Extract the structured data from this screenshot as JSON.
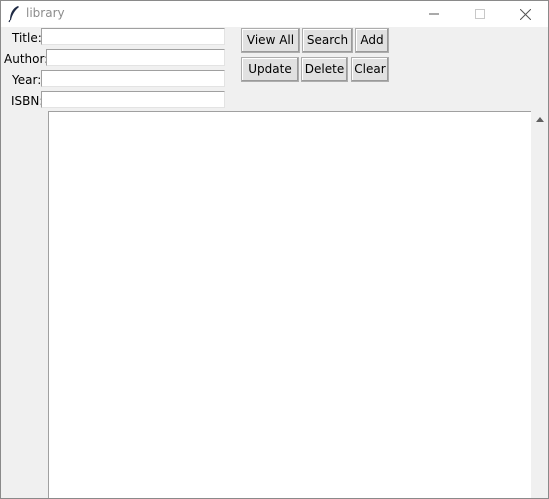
{
  "window": {
    "title": "library",
    "icon": "feather-icon",
    "controls": {
      "minimize": "minimize-icon",
      "maximize": "maximize-icon",
      "close": "close-icon"
    }
  },
  "form": {
    "title_label": "Title:",
    "author_label": "Author:",
    "year_label": "Year:",
    "isbn_label": "ISBN:",
    "title_value": "",
    "author_value": "",
    "year_value": "",
    "isbn_value": ""
  },
  "buttons": {
    "view_all": "View All",
    "search": "Search",
    "add": "Add",
    "update": "Update",
    "delete": "Delete",
    "clear": "Clear"
  },
  "results": {
    "items": []
  },
  "colors": {
    "window_bg": "#f0f0f0",
    "titlebar_bg": "#ffffff",
    "title_text": "#8c8c8c"
  }
}
